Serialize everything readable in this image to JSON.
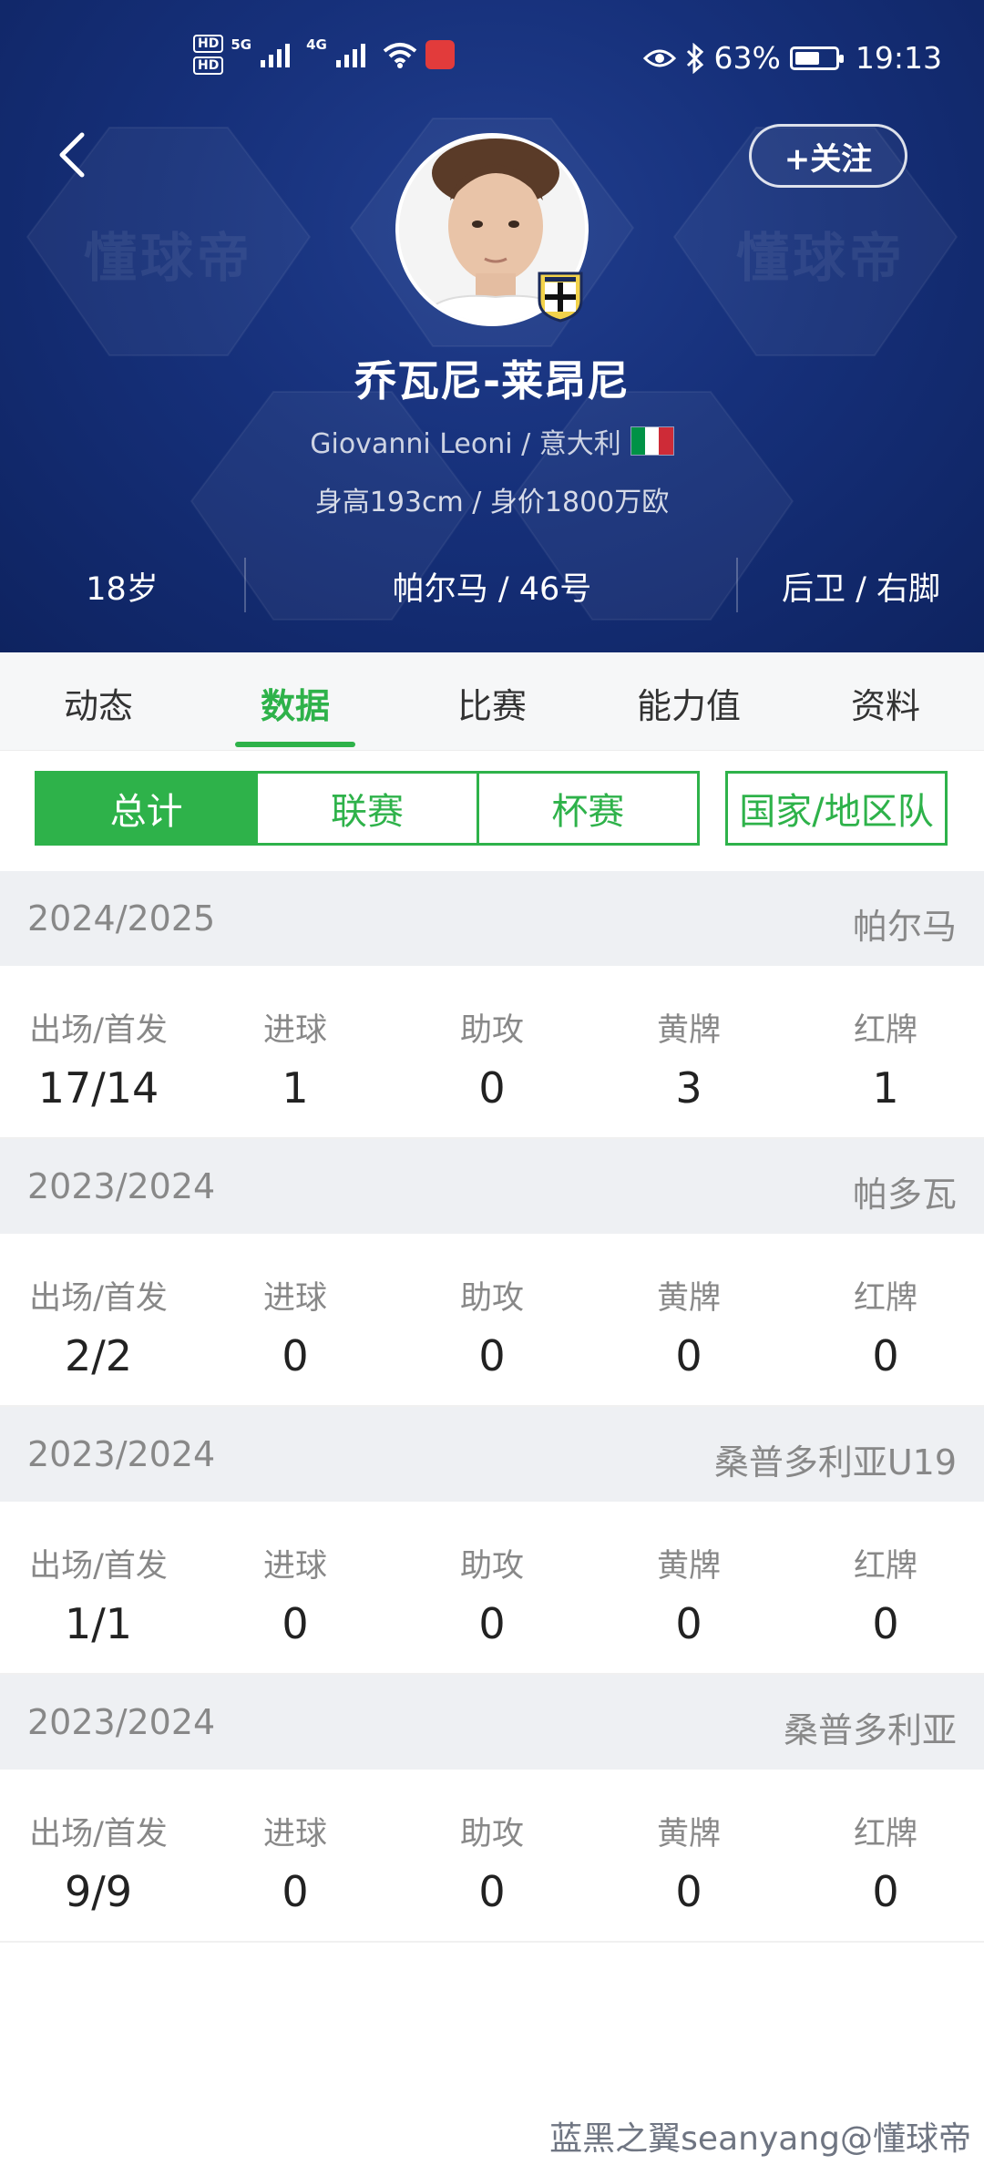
{
  "status_bar": {
    "hd1": "HD",
    "hd2": "HD",
    "net1": "5G",
    "net2": "4G",
    "battery_percent": "63%",
    "battery_level": 0.63,
    "time": "19:13"
  },
  "header": {
    "follow_label": "+关注",
    "watermark": "懂球帝",
    "player_name": "乔瓦尼-莱昂尼",
    "latin_name_nation": "Giovanni Leoni / 意大利",
    "height_value_line": "身高193cm / 身价1800万欧",
    "age": "18岁",
    "club_number": "帕尔马 / 46号",
    "position_foot": "后卫 / 右脚"
  },
  "tabs": [
    {
      "label": "动态"
    },
    {
      "label": "数据"
    },
    {
      "label": "比赛"
    },
    {
      "label": "能力值"
    },
    {
      "label": "资料"
    }
  ],
  "segments": [
    {
      "label": "总计"
    },
    {
      "label": "联赛"
    },
    {
      "label": "杯赛"
    },
    {
      "label": "国家/地区队"
    }
  ],
  "stat_labels": {
    "apps": "出场/首发",
    "goals": "进球",
    "assists": "助攻",
    "yellow": "黄牌",
    "red": "红牌"
  },
  "seasons": [
    {
      "season": "2024/2025",
      "club": "帕尔马",
      "apps": "17/14",
      "goals": "1",
      "assists": "0",
      "yellow": "3",
      "red": "1"
    },
    {
      "season": "2023/2024",
      "club": "帕多瓦",
      "apps": "2/2",
      "goals": "0",
      "assists": "0",
      "yellow": "0",
      "red": "0"
    },
    {
      "season": "2023/2024",
      "club": "桑普多利亚U19",
      "apps": "1/1",
      "goals": "0",
      "assists": "0",
      "yellow": "0",
      "red": "0"
    },
    {
      "season": "2023/2024",
      "club": "桑普多利亚",
      "apps": "9/9",
      "goals": "0",
      "assists": "0",
      "yellow": "0",
      "red": "0"
    }
  ],
  "footer_watermark": "蓝黑之翼seanyang@懂球帝",
  "colors": {
    "header_bg": "#16307a",
    "accent_green": "#2eb24a",
    "season_bg": "#eef0f3",
    "flag_green": "#009246",
    "flag_white": "#ffffff",
    "flag_red": "#ce2b37"
  }
}
